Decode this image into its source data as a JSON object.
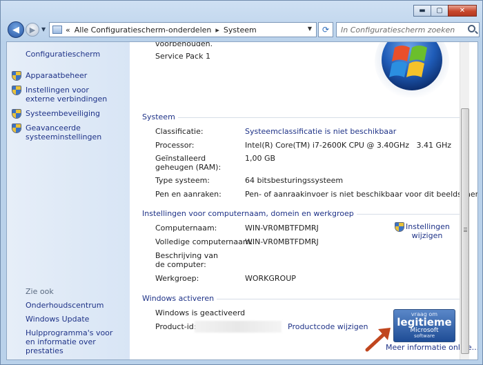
{
  "window": {
    "minimize": "▬",
    "maximize": "▢",
    "close": "✕"
  },
  "nav": {
    "history_arrows": "«",
    "breadcrumb": [
      "Alle Configuratiescherm-onderdelen",
      "Systeem"
    ],
    "breadcrumb_sep": "▸",
    "search_placeholder": "In Configuratiescherm zoeken"
  },
  "sidebar": {
    "home": "Configuratiescherm",
    "items": [
      {
        "label": "Apparaatbeheer"
      },
      {
        "label": "Instellingen voor externe verbindingen"
      },
      {
        "label": "Systeembeveiliging"
      },
      {
        "label": "Geavanceerde systeeminstellingen"
      }
    ],
    "see_also": "Zie ook",
    "links": [
      "Onderhoudscentrum",
      "Windows Update",
      "Hulpprogramma's voor en informatie over prestaties"
    ]
  },
  "top": {
    "cut_text": "voorbehouden.",
    "service_pack": "Service Pack 1"
  },
  "system": {
    "title": "Systeem",
    "rows": [
      {
        "label": "Classificatie:",
        "value": "Systeemclassificatie is niet beschikbaar"
      },
      {
        "label": "Processor:",
        "value": "Intel(R) Core(TM) i7-2600K CPU @ 3.40GHz   3.41 GHz"
      },
      {
        "label": "Geïnstalleerd geheugen (RAM):",
        "value": "1,00 GB"
      },
      {
        "label": "Type systeem:",
        "value": "64 bitsbesturingssysteem"
      },
      {
        "label": "Pen en aanraken:",
        "value": "Pen- of aanraakinvoer is niet beschikbaar voor dit beeldscherm"
      }
    ]
  },
  "computer": {
    "title": "Instellingen voor computernaam, domein en werkgroep",
    "rows": [
      {
        "label": "Computernaam:",
        "value": "WIN-VR0MBTFDMRJ"
      },
      {
        "label": "Volledige computernaam:",
        "value": "WIN-VR0MBTFDMRJ"
      },
      {
        "label": "Beschrijving van de computer:",
        "value": ""
      },
      {
        "label": "Werkgroep:",
        "value": "WORKGROUP"
      }
    ],
    "change_link": "Instellingen wijzigen"
  },
  "activation": {
    "title": "Windows activeren",
    "status": "Windows is geactiveerd",
    "product_id_label": "Product-id:",
    "product_key_link": "Productcode wijzigen",
    "genuine_line1": "vraag om",
    "genuine_line2": "legitieme",
    "genuine_line3": "Microsoft",
    "genuine_line4": "software",
    "more_info": "Meer informatie online..."
  },
  "colors": {
    "link": "#1e3287",
    "accent_arrow": "#c0461e"
  }
}
